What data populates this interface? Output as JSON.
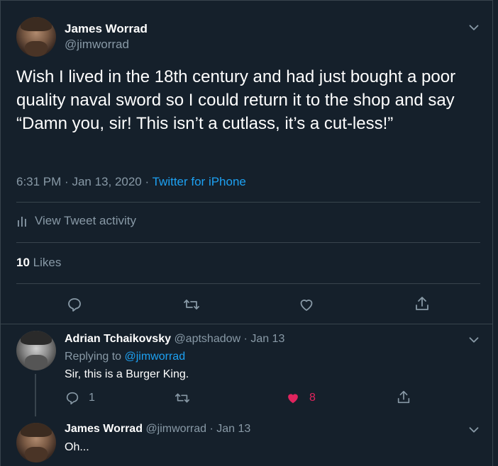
{
  "main_tweet": {
    "author_name": "James Worrad",
    "author_handle": "@jimworrad",
    "text": "Wish I lived in the 18th century and had just bought a poor quality naval sword so I could return it to the shop and say “Damn you, sir! This isn’t a cutlass, it’s a cut-less!”",
    "time": "6:31 PM",
    "date": "Jan 13, 2020",
    "separator": "·",
    "source": "Twitter for iPhone",
    "activity_label": "View Tweet activity",
    "likes_count": "10",
    "likes_label": "Likes"
  },
  "reply1": {
    "author_name": "Adrian Tchaikovsky",
    "author_handle": "@aptshadow",
    "date": "Jan 13",
    "separator": "·",
    "replying_label": "Replying to",
    "replying_handle": "@jimworrad",
    "text": "Sir, this is a Burger King.",
    "reply_count": "1",
    "like_count": "8"
  },
  "reply2": {
    "author_name": "James Worrad",
    "author_handle": "@jimworrad",
    "date": "Jan 13",
    "separator": "·",
    "text": "Oh..."
  },
  "colors": {
    "background": "#15202b",
    "border": "#38444d",
    "secondary_text": "#8899a6",
    "link": "#1da1f2",
    "like": "#e0245e"
  }
}
